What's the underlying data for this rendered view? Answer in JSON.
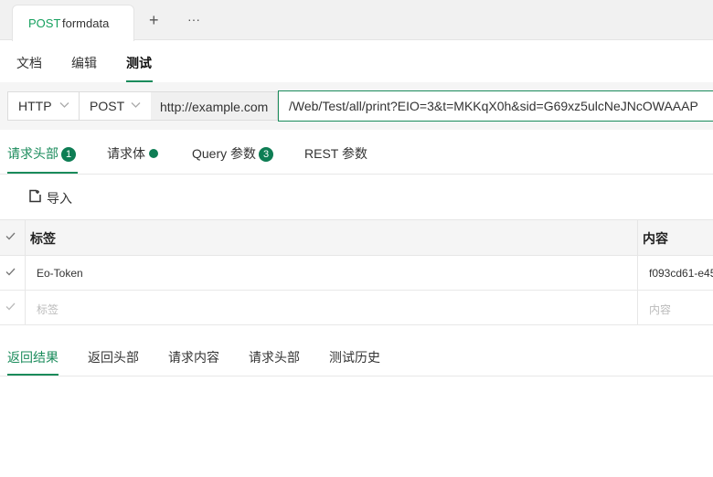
{
  "doc_tab": {
    "method": "POST",
    "name": "formdata"
  },
  "tabstrip": {
    "add_icon": "plus-icon",
    "add_glyph": "+",
    "more_icon": "more-icon",
    "more_glyph": "···"
  },
  "subnav": {
    "items": [
      "文档",
      "编辑",
      "测试"
    ],
    "active": "测试"
  },
  "url": {
    "protocol": "HTTP",
    "method": "POST",
    "host": "http://example.com",
    "path": "/Web/Test/all/print?EIO=3&t=MKKqX0h&sid=G69xz5ulcNeJNcOWAAAP"
  },
  "request_tabs": {
    "headers": {
      "label": "请求头部",
      "count": "1"
    },
    "body": {
      "label": "请求体"
    },
    "query": {
      "label": "Query 参数",
      "count": "3"
    },
    "rest": {
      "label": "REST 参数"
    }
  },
  "import_label": "导入",
  "table": {
    "headers": {
      "label": "标签",
      "value": "内容"
    },
    "rows": [
      {
        "checked": true,
        "label": "Eo-Token",
        "value": "f093cd61-e45"
      }
    ],
    "placeholder": {
      "label": "标签",
      "value": "内容"
    }
  },
  "response_tabs": [
    "返回结果",
    "返回头部",
    "请求内容",
    "请求头部",
    "测试历史"
  ],
  "colors": {
    "accent": "#1a8b5b",
    "method_green": "#16a05e",
    "badge": "#0e7d54"
  }
}
